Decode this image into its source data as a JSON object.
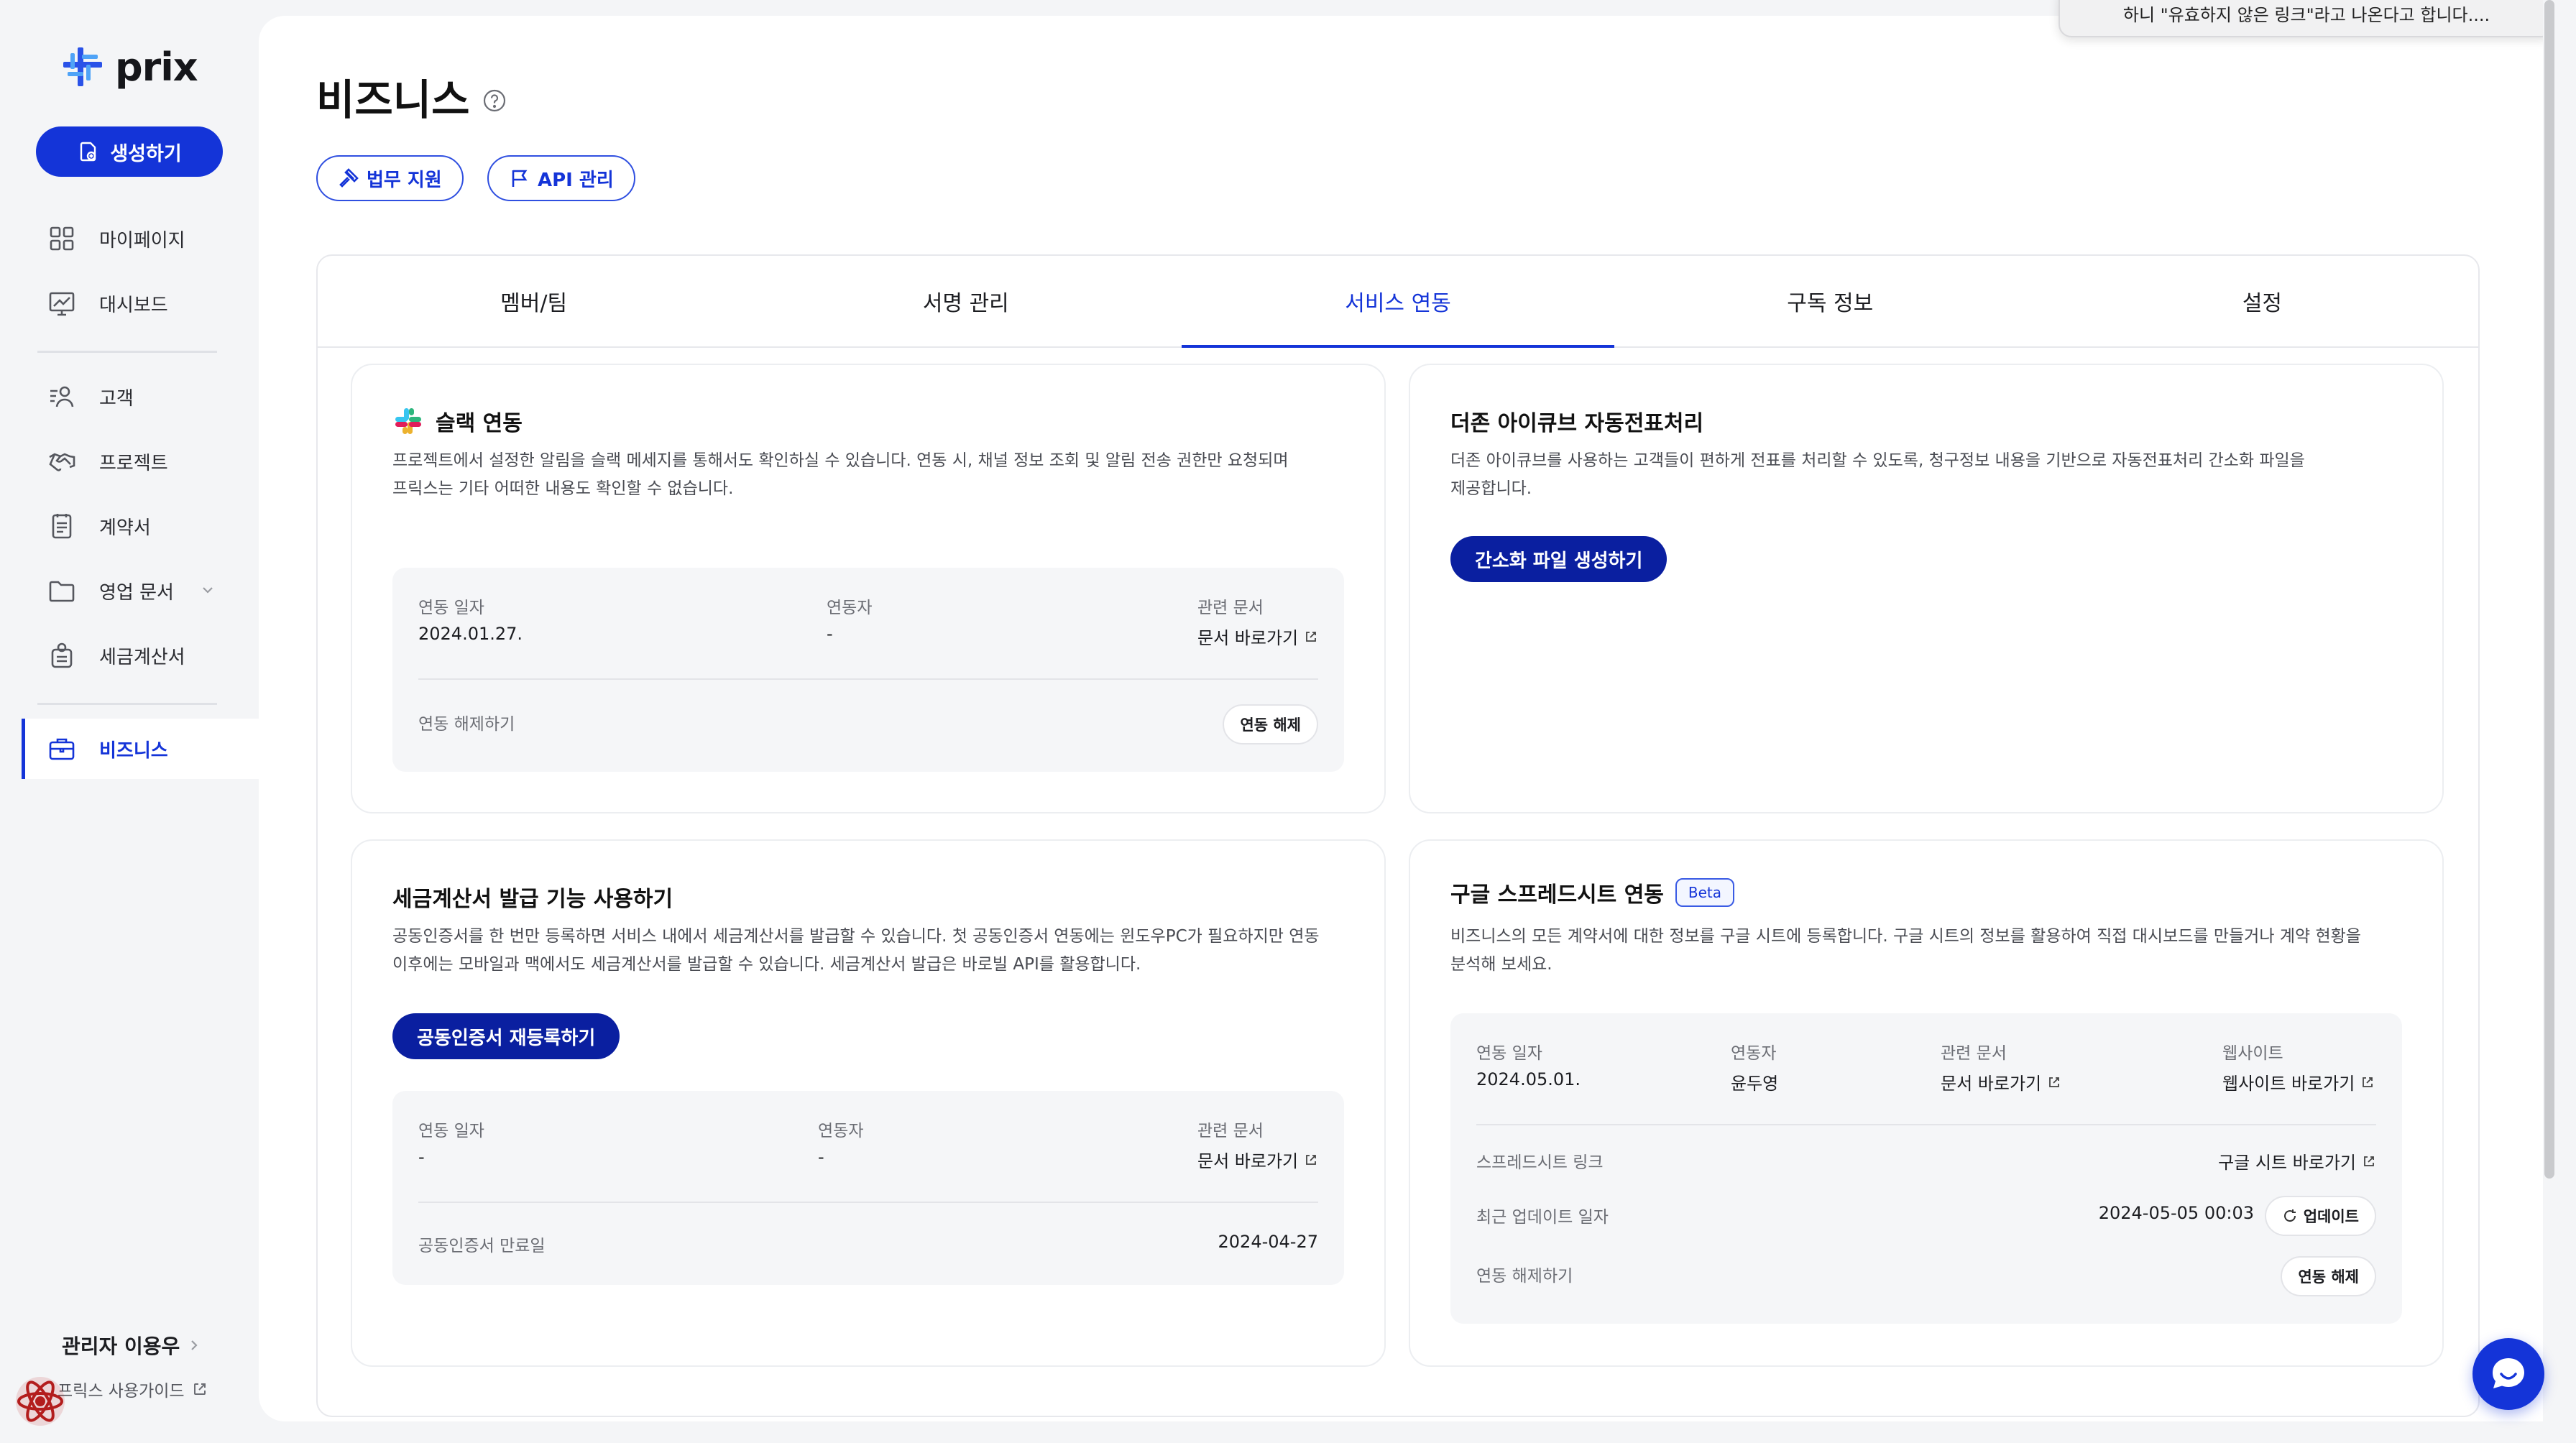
{
  "app": {
    "name": "prix"
  },
  "sidebar": {
    "create_label": "생성하기",
    "items": [
      {
        "label": "마이페이지",
        "icon": "grid-icon"
      },
      {
        "label": "대시보드",
        "icon": "chart-icon"
      },
      {
        "label": "고객",
        "icon": "customers-icon"
      },
      {
        "label": "프로젝트",
        "icon": "handshake-icon"
      },
      {
        "label": "계약서",
        "icon": "document-icon"
      },
      {
        "label": "영업 문서",
        "icon": "folder-icon"
      },
      {
        "label": "세금계산서",
        "icon": "receipt-icon"
      },
      {
        "label": "비즈니스",
        "icon": "briefcase-icon",
        "active": true
      }
    ],
    "admin_label": "관리자 이용우",
    "guide_label": "프릭스 사용가이드"
  },
  "header": {
    "title": "비즈니스",
    "pills": [
      {
        "label": "법무 지원",
        "icon": "gavel-icon"
      },
      {
        "label": "API 관리",
        "icon": "flag-icon"
      }
    ]
  },
  "tabs": [
    {
      "label": "멤버/팀"
    },
    {
      "label": "서명 관리"
    },
    {
      "label": "서비스 연동",
      "active": true
    },
    {
      "label": "구독 정보"
    },
    {
      "label": "설정"
    }
  ],
  "cards": {
    "slack": {
      "title": "슬랙 연동",
      "desc_line1": "프로젝트에서 설정한 알림을 슬랙 메세지를 통해서도 확인하실 수 있습니다. 연동 시, 채널 정보 조회 및 알림 전송 권한만 요청되며",
      "desc_line2": "프릭스는 기타 어떠한 내용도 확인할 수 없습니다.",
      "date_label": "연동 일자",
      "date_value": "2024.01.27.",
      "user_label": "연동자",
      "user_value": "-",
      "doc_label": "관련 문서",
      "doc_value": "문서 바로가기",
      "unlink_label": "연동 해제하기",
      "unlink_button": "연동 해제"
    },
    "douzone": {
      "title": "더존 아이큐브 자동전표처리",
      "desc_line1": "더존 아이큐브를 사용하는 고객들이 편하게 전표를 처리할 수 있도록, 청구정보 내용을 기반으로 자동전표처리 간소화 파일을",
      "desc_line2": "제공합니다.",
      "button": "간소화 파일 생성하기"
    },
    "tax": {
      "title": "세금계산서 발급 기능 사용하기",
      "desc_line1": "공동인증서를 한 번만 등록하면 서비스 내에서 세금계산서를 발급할 수 있습니다. 첫 공동인증서 연동에는 윈도우PC가 필요하지만 연동",
      "desc_line2": "이후에는 모바일과 맥에서도 세금계산서를 발급할 수 있습니다. 세금계산서 발급은 바로빌 API를 활용합니다.",
      "button": "공동인증서 재등록하기",
      "date_label": "연동 일자",
      "date_value": "-",
      "user_label": "연동자",
      "user_value": "-",
      "doc_label": "관련 문서",
      "doc_value": "문서 바로가기",
      "expiry_label": "공동인증서 만료일",
      "expiry_value": "2024-04-27"
    },
    "gsheet": {
      "title": "구글 스프레드시트 연동",
      "badge": "Beta",
      "desc_line1": "비즈니스의 모든 계약서에 대한 정보를 구글 시트에 등록합니다. 구글 시트의 정보를 활용하여 직접 대시보드를 만들거나 계약 현황을",
      "desc_line2": "분석해 보세요.",
      "date_label": "연동 일자",
      "date_value": "2024.05.01.",
      "user_label": "연동자",
      "user_value": "윤두영",
      "doc_label": "관련 문서",
      "doc_value": "문서 바로가기",
      "site_label": "웹사이트",
      "site_value": "웹사이트 바로가기",
      "sheet_label": "스프레드시트 링크",
      "sheet_value": "구글 시트 바로가기",
      "updated_label": "최근 업데이트 일자",
      "updated_value": "2024-05-05 00:03",
      "update_button": "업데이트",
      "unlink_label": "연동 해제하기",
      "unlink_button": "연동 해제"
    }
  },
  "toast": {
    "text": "하니 \"유효하지 않은 링크\"라고 나온다고 합니다...."
  },
  "colors": {
    "accent": "#1434d8",
    "accent_dark": "#0a1fa0",
    "background": "#f4f5f7"
  }
}
